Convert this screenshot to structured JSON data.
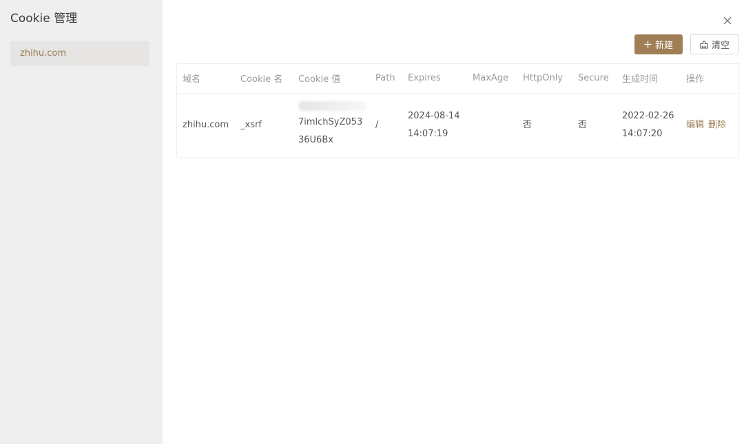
{
  "sidebar": {
    "title": "Cookie 管理",
    "items": [
      {
        "label": "zhihu.com",
        "selected": true
      }
    ]
  },
  "toolbar": {
    "new_label": "新建",
    "clear_label": "清空"
  },
  "table": {
    "headers": [
      "域名",
      "Cookie 名",
      "Cookie 值",
      "Path",
      "Expires",
      "MaxAge",
      "HttpOnly",
      "Secure",
      "生成时间",
      "操作"
    ],
    "rows": [
      {
        "domain": "zhihu.com",
        "name": "_xsrf",
        "value": "7imlchSyZ05336U6Bx",
        "path": "/",
        "expires": "2024-08-14 14:07:19",
        "maxage": "",
        "httponly": "否",
        "secure": "否",
        "created": "2022-02-26 14:07:20",
        "edit_label": "编辑",
        "delete_label": "删除"
      }
    ]
  },
  "colors": {
    "accent": "#a07f56",
    "sidebar_bg": "#efeff0",
    "selected_item_bg": "#e6e5e3"
  },
  "icons": {
    "close": "close-icon",
    "new": "plus-icon",
    "clear": "broom-icon"
  }
}
